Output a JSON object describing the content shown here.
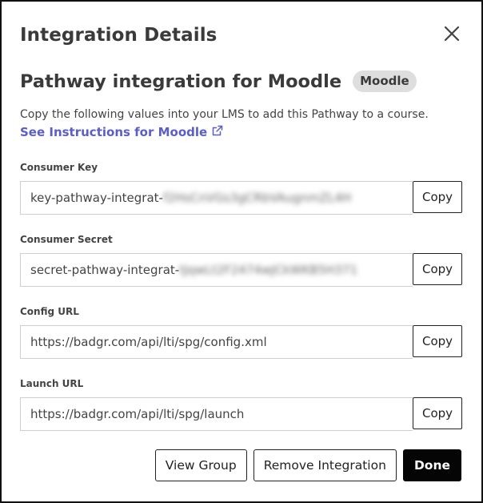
{
  "modal": {
    "title": "Integration Details",
    "close_icon": "close-icon"
  },
  "pathway": {
    "title": "Pathway integration for Moodle",
    "badge": "Moodle"
  },
  "description": "Copy the following values into your LMS to add this Pathway to a course.",
  "instructions_link": {
    "label": "See Instructions for Moodle",
    "icon": "external-link-icon"
  },
  "fields": [
    {
      "label": "Consumer Key",
      "value_visible": "key-pathway-integrat-",
      "value_obscured": "f2HsCnVGs3gCRbVAugnmZL4H",
      "copy_label": "Copy"
    },
    {
      "label": "Consumer Secret",
      "value_visible": "secret-pathway-integrat-",
      "value_obscured": "tJqwLt2F2474wJCkWKB5H371",
      "copy_label": "Copy"
    },
    {
      "label": "Config URL",
      "value_visible": "https://badgr.com/api/lti/spg/config.xml",
      "value_obscured": "",
      "copy_label": "Copy"
    },
    {
      "label": "Launch URL",
      "value_visible": "https://badgr.com/api/lti/spg/launch",
      "value_obscured": "",
      "copy_label": "Copy"
    }
  ],
  "footer": {
    "view_group": "View Group",
    "remove_integration": "Remove Integration",
    "done": "Done"
  },
  "colors": {
    "link": "#5a5ec6",
    "badge_bg": "#dedede",
    "primary_button": "#050505"
  }
}
